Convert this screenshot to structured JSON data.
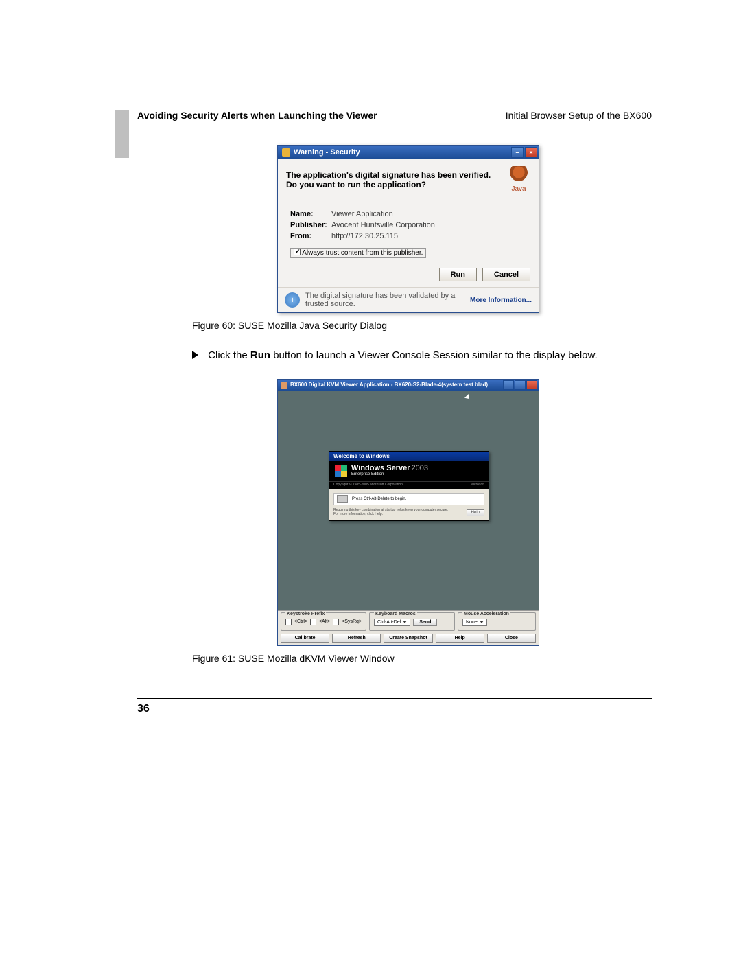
{
  "header": {
    "left": "Avoiding Security Alerts when Launching the Viewer",
    "right": "Initial Browser Setup of the BX600"
  },
  "captions": {
    "fig60": "Figure 60: SUSE Mozilla Java Security Dialog",
    "fig61": "Figure 61: SUSE Mozilla dKVM Viewer Window"
  },
  "paragraph": {
    "pre": "Click the ",
    "bold": "Run",
    "post": " button to launch a Viewer Console Session similar to the display below."
  },
  "java": {
    "title": "Warning - Security",
    "message": "The application's digital signature has been verified.  Do you want to run the application?",
    "logo_text": "Java",
    "name_label": "Name:",
    "name_value": "Viewer Application",
    "publisher_label": "Publisher:",
    "publisher_value": "Avocent Huntsville Corporation",
    "from_label": "From:",
    "from_value": "http://172.30.25.115",
    "always_trust": "Always trust content from this publisher.",
    "run_btn": "Run",
    "cancel_btn": "Cancel",
    "footer_text": "The digital signature has been validated by a trusted source.",
    "more_info": "More Information..."
  },
  "kvm": {
    "title": "BX600 Digital KVM Viewer Application - BX620-S2-Blade-4(system test blad)",
    "welcome_bar": "Welcome to Windows",
    "product": "Windows Server",
    "year": "2003",
    "edition": "Enterprise Edition",
    "copyright": "Copyright © 1985-2005  Microsoft Corporation",
    "ms": "Microsoft",
    "press_msg": "Press Ctrl-Alt-Delete to begin.",
    "key_msg": "Requiring this key combination at startup helps keep your computer secure. For more information, click Help.",
    "help": "Help",
    "panel_keystroke": "Keystroke Prefix",
    "kp_ctrl": "<Ctrl>",
    "kp_alt": "<Alt>",
    "kp_sysrq": "<SysRq>",
    "panel_macros": "Keyboard Macros",
    "macro_value": "Ctrl-Alt-Del",
    "send": "Send",
    "panel_mouse": "Mouse Acceleration",
    "mouse_value": "None",
    "btn_calibrate": "Calibrate",
    "btn_refresh": "Refresh",
    "btn_snapshot": "Create Snapshot",
    "btn_help": "Help",
    "btn_close": "Close"
  },
  "page_number": "36"
}
